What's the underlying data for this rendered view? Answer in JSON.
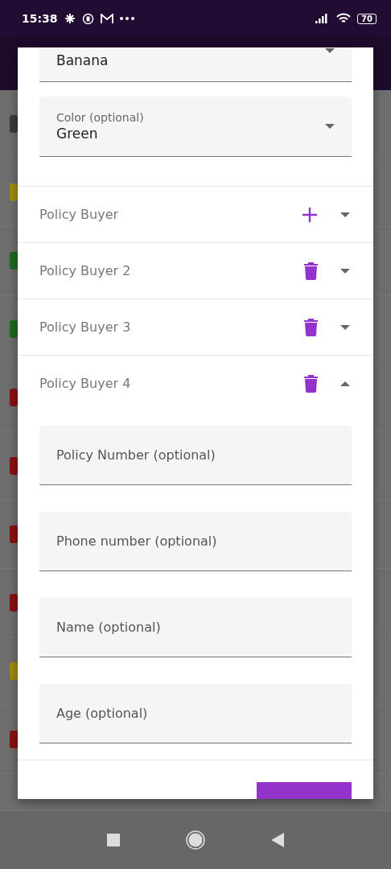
{
  "status_bar": {
    "time": "15:38",
    "battery": "70"
  },
  "background_rows": [
    {
      "color": "#3a3a3a"
    },
    {
      "color": "#a08a10"
    },
    {
      "color": "#1f6a1f"
    },
    {
      "color": "#1f6a1f"
    },
    {
      "color": "#8a1010"
    },
    {
      "color": "#8a1010"
    },
    {
      "color": "#8a1010"
    },
    {
      "color": "#8a1010"
    },
    {
      "color": "#a08a10"
    },
    {
      "color": "#8a1010"
    }
  ],
  "dialog": {
    "fields": [
      {
        "kind": "select",
        "value": "Banana"
      },
      {
        "kind": "select",
        "label": "Color (optional)",
        "value": "Green"
      }
    ],
    "sections": [
      {
        "title": "Policy Buyer",
        "kind": "add",
        "expanded": false
      },
      {
        "title": "Policy Buyer 2",
        "kind": "delete",
        "expanded": false
      },
      {
        "title": "Policy Buyer 3",
        "kind": "delete",
        "expanded": false
      },
      {
        "title": "Policy Buyer 4",
        "kind": "delete",
        "expanded": true,
        "fields": [
          {
            "placeholder": "Policy Number (optional)"
          },
          {
            "placeholder": "Phone number (optional)"
          },
          {
            "placeholder": "Name (optional)"
          },
          {
            "placeholder": "Age (optional)"
          }
        ]
      }
    ]
  }
}
